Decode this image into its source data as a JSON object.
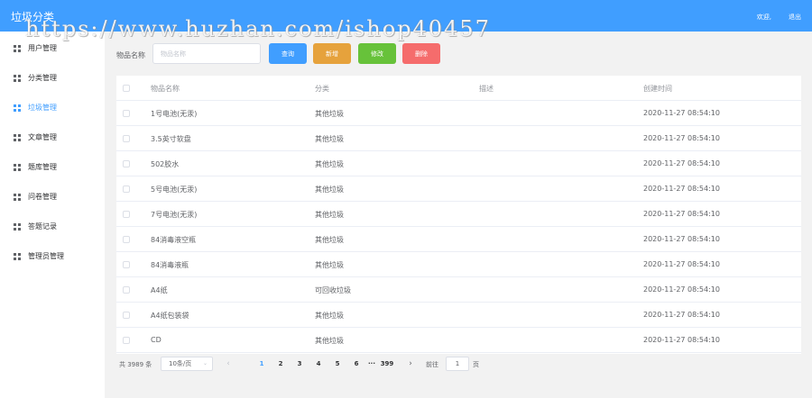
{
  "header": {
    "title": "垃圾分类",
    "welcome": "欢迎,",
    "logout": "退出"
  },
  "watermark": "https://www.huzhan.com/ishop40457",
  "sidebar": {
    "items": [
      {
        "label": "用户管理"
      },
      {
        "label": "分类管理"
      },
      {
        "label": "垃圾管理",
        "active": true
      },
      {
        "label": "文章管理"
      },
      {
        "label": "题库管理"
      },
      {
        "label": "问卷管理"
      },
      {
        "label": "答题记录"
      },
      {
        "label": "管理员管理"
      }
    ]
  },
  "search": {
    "label": "物品名称",
    "placeholder": "物品名称",
    "query_label": "查询",
    "add_label": "新增",
    "edit_label": "修改",
    "delete_label": "删除"
  },
  "table": {
    "headers": {
      "name": "物品名称",
      "category": "分类",
      "description": "描述",
      "created": "创建时间"
    },
    "rows": [
      {
        "name": "1号电池(无汞)",
        "category": "其他垃圾",
        "description": "",
        "created": "2020-11-27 08:54:10"
      },
      {
        "name": "3.5英寸软盘",
        "category": "其他垃圾",
        "description": "",
        "created": "2020-11-27 08:54:10"
      },
      {
        "name": "502胶水",
        "category": "其他垃圾",
        "description": "",
        "created": "2020-11-27 08:54:10"
      },
      {
        "name": "5号电池(无汞)",
        "category": "其他垃圾",
        "description": "",
        "created": "2020-11-27 08:54:10"
      },
      {
        "name": "7号电池(无汞)",
        "category": "其他垃圾",
        "description": "",
        "created": "2020-11-27 08:54:10"
      },
      {
        "name": "84消毒液空瓶",
        "category": "其他垃圾",
        "description": "",
        "created": "2020-11-27 08:54:10"
      },
      {
        "name": "84消毒液瓶",
        "category": "其他垃圾",
        "description": "",
        "created": "2020-11-27 08:54:10"
      },
      {
        "name": "A4纸",
        "category": "可回收垃圾",
        "description": "",
        "created": "2020-11-27 08:54:10"
      },
      {
        "name": "A4纸包装袋",
        "category": "其他垃圾",
        "description": "",
        "created": "2020-11-27 08:54:10"
      },
      {
        "name": "CD",
        "category": "其他垃圾",
        "description": "",
        "created": "2020-11-27 08:54:10"
      }
    ]
  },
  "pagination": {
    "total": "共 3989 条",
    "page_size": "10条/页",
    "pages": [
      "1",
      "2",
      "3",
      "4",
      "5",
      "6",
      "···",
      "399"
    ],
    "current": "1",
    "goto_label": "前往",
    "goto_value": "1",
    "page_unit": "页"
  },
  "colors": {
    "primary": "#409eff",
    "warning": "#e6a23c",
    "success": "#67c23a",
    "danger": "#f56c6c"
  }
}
